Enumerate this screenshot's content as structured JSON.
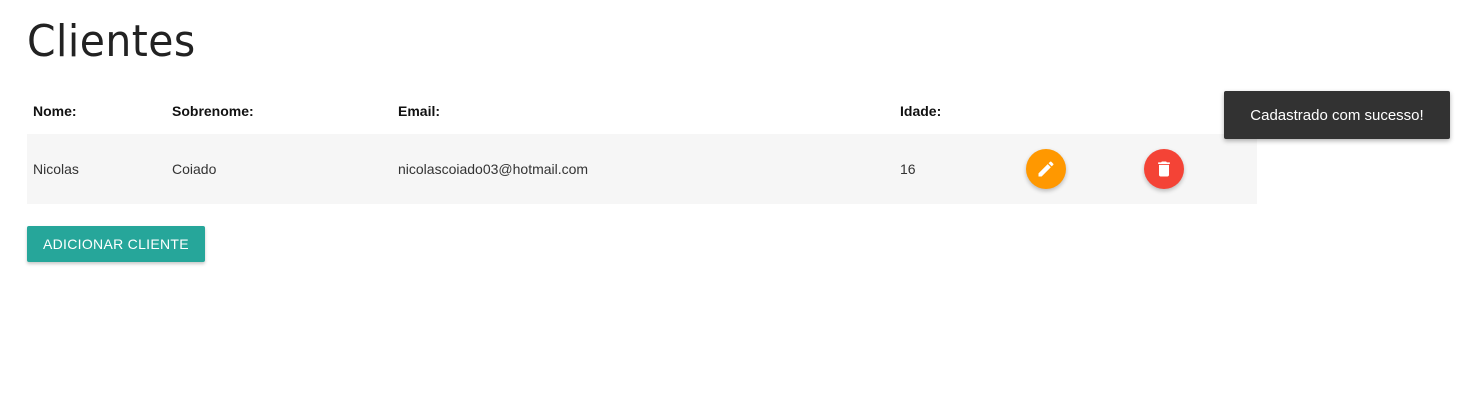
{
  "page": {
    "title": "Clientes"
  },
  "table": {
    "headers": {
      "nome": "Nome:",
      "sobrenome": "Sobrenome:",
      "email": "Email:",
      "idade": "Idade:"
    },
    "rows": [
      {
        "nome": "Nicolas",
        "sobrenome": "Coiado",
        "email": "nicolascoiado03@hotmail.com",
        "idade": "16",
        "edit_icon": "pencil-icon",
        "delete_icon": "trash-icon"
      }
    ]
  },
  "actions": {
    "add_label": "ADICIONAR CLIENTE"
  },
  "toast": {
    "message": "Cadastrado com sucesso!"
  },
  "colors": {
    "edit": "#ff9800",
    "delete": "#f44336",
    "primary": "#26a69a",
    "toast_bg": "#323232",
    "row_bg": "#f6f6f6"
  }
}
